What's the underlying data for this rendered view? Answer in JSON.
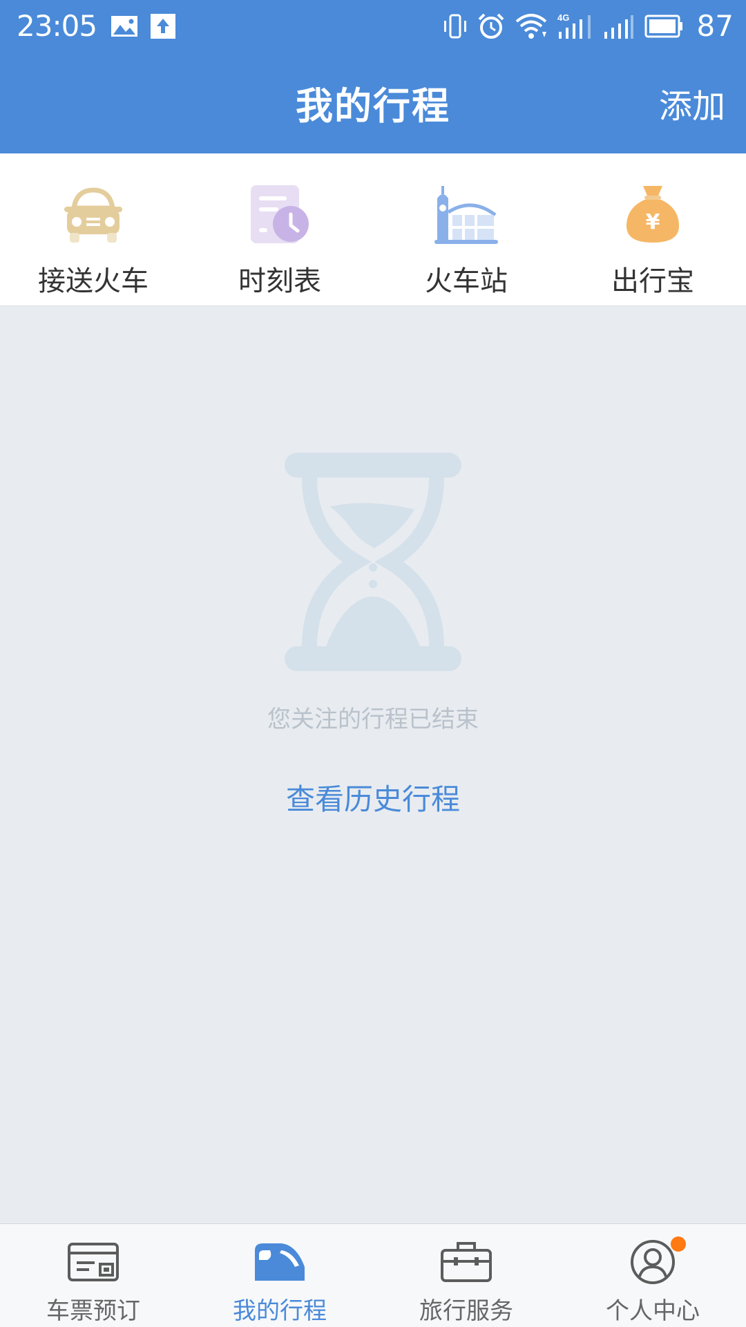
{
  "status_bar": {
    "time": "23:05",
    "battery": "87",
    "network": "4G",
    "icons": [
      "image-icon",
      "upload-icon",
      "vibrate-icon",
      "alarm-icon",
      "wifi-icon",
      "signal-4g-icon",
      "signal-icon",
      "battery-icon"
    ]
  },
  "header": {
    "title": "我的行程",
    "add_label": "添加"
  },
  "quick_actions": [
    {
      "label": "接送火车",
      "icon": "car-icon",
      "color": "#e4cd9c"
    },
    {
      "label": "时刻表",
      "icon": "timetable-icon",
      "color": "#c8b3e6"
    },
    {
      "label": "火车站",
      "icon": "train-station-icon",
      "color": "#8ab0ea"
    },
    {
      "label": "出行宝",
      "icon": "money-bag-icon",
      "color": "#f5b765"
    }
  ],
  "empty_state": {
    "icon": "hourglass-icon",
    "message": "您关注的行程已结束",
    "link_label": "查看历史行程"
  },
  "bottom_nav": [
    {
      "label": "车票预订",
      "icon": "ticket-icon",
      "active": false
    },
    {
      "label": "我的行程",
      "icon": "train-icon",
      "active": true
    },
    {
      "label": "旅行服务",
      "icon": "suitcase-icon",
      "active": false
    },
    {
      "label": "个人中心",
      "icon": "user-icon",
      "active": false,
      "badge": true
    }
  ],
  "colors": {
    "primary": "#4a8ad9",
    "background": "#e8ecf0",
    "badge": "#ff7a12"
  }
}
